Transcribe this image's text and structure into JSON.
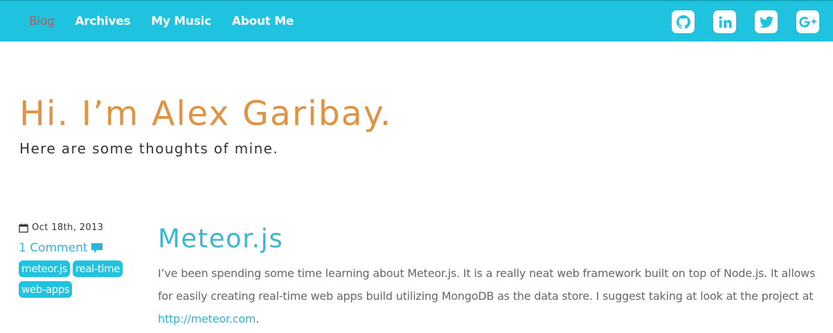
{
  "nav": {
    "items": [
      {
        "label": "Blog",
        "active": true
      },
      {
        "label": "Archives",
        "active": false
      },
      {
        "label": "My Music",
        "active": false
      },
      {
        "label": "About Me",
        "active": false
      }
    ]
  },
  "social": {
    "icons": [
      "github-icon",
      "linkedin-icon",
      "twitter-icon",
      "google-plus-icon"
    ]
  },
  "hero": {
    "title": "Hi. I’m Alex Garibay.",
    "subtitle": "Here are some thoughts of mine."
  },
  "post": {
    "date": "Oct 18th, 2013",
    "comments": "1 Comment",
    "tags": [
      "meteor.js",
      "real-time",
      "web-apps"
    ],
    "title": "Meteor.js",
    "body_before_link": "I’ve been spending some time learning about Meteor.js. It is a really neat web framework built on top of Node.js. It allows for easily creating real-time web apps build utilizing MongoDB as the data store. I suggest taking at look at the project at ",
    "link_text": "http://meteor.com",
    "body_after_link": "."
  },
  "colors": {
    "topbar": "#1fc3df",
    "active_nav": "#b65a55",
    "hero_title": "#e09342",
    "post_title": "#3fb6cf",
    "link": "#2bb5d8"
  }
}
